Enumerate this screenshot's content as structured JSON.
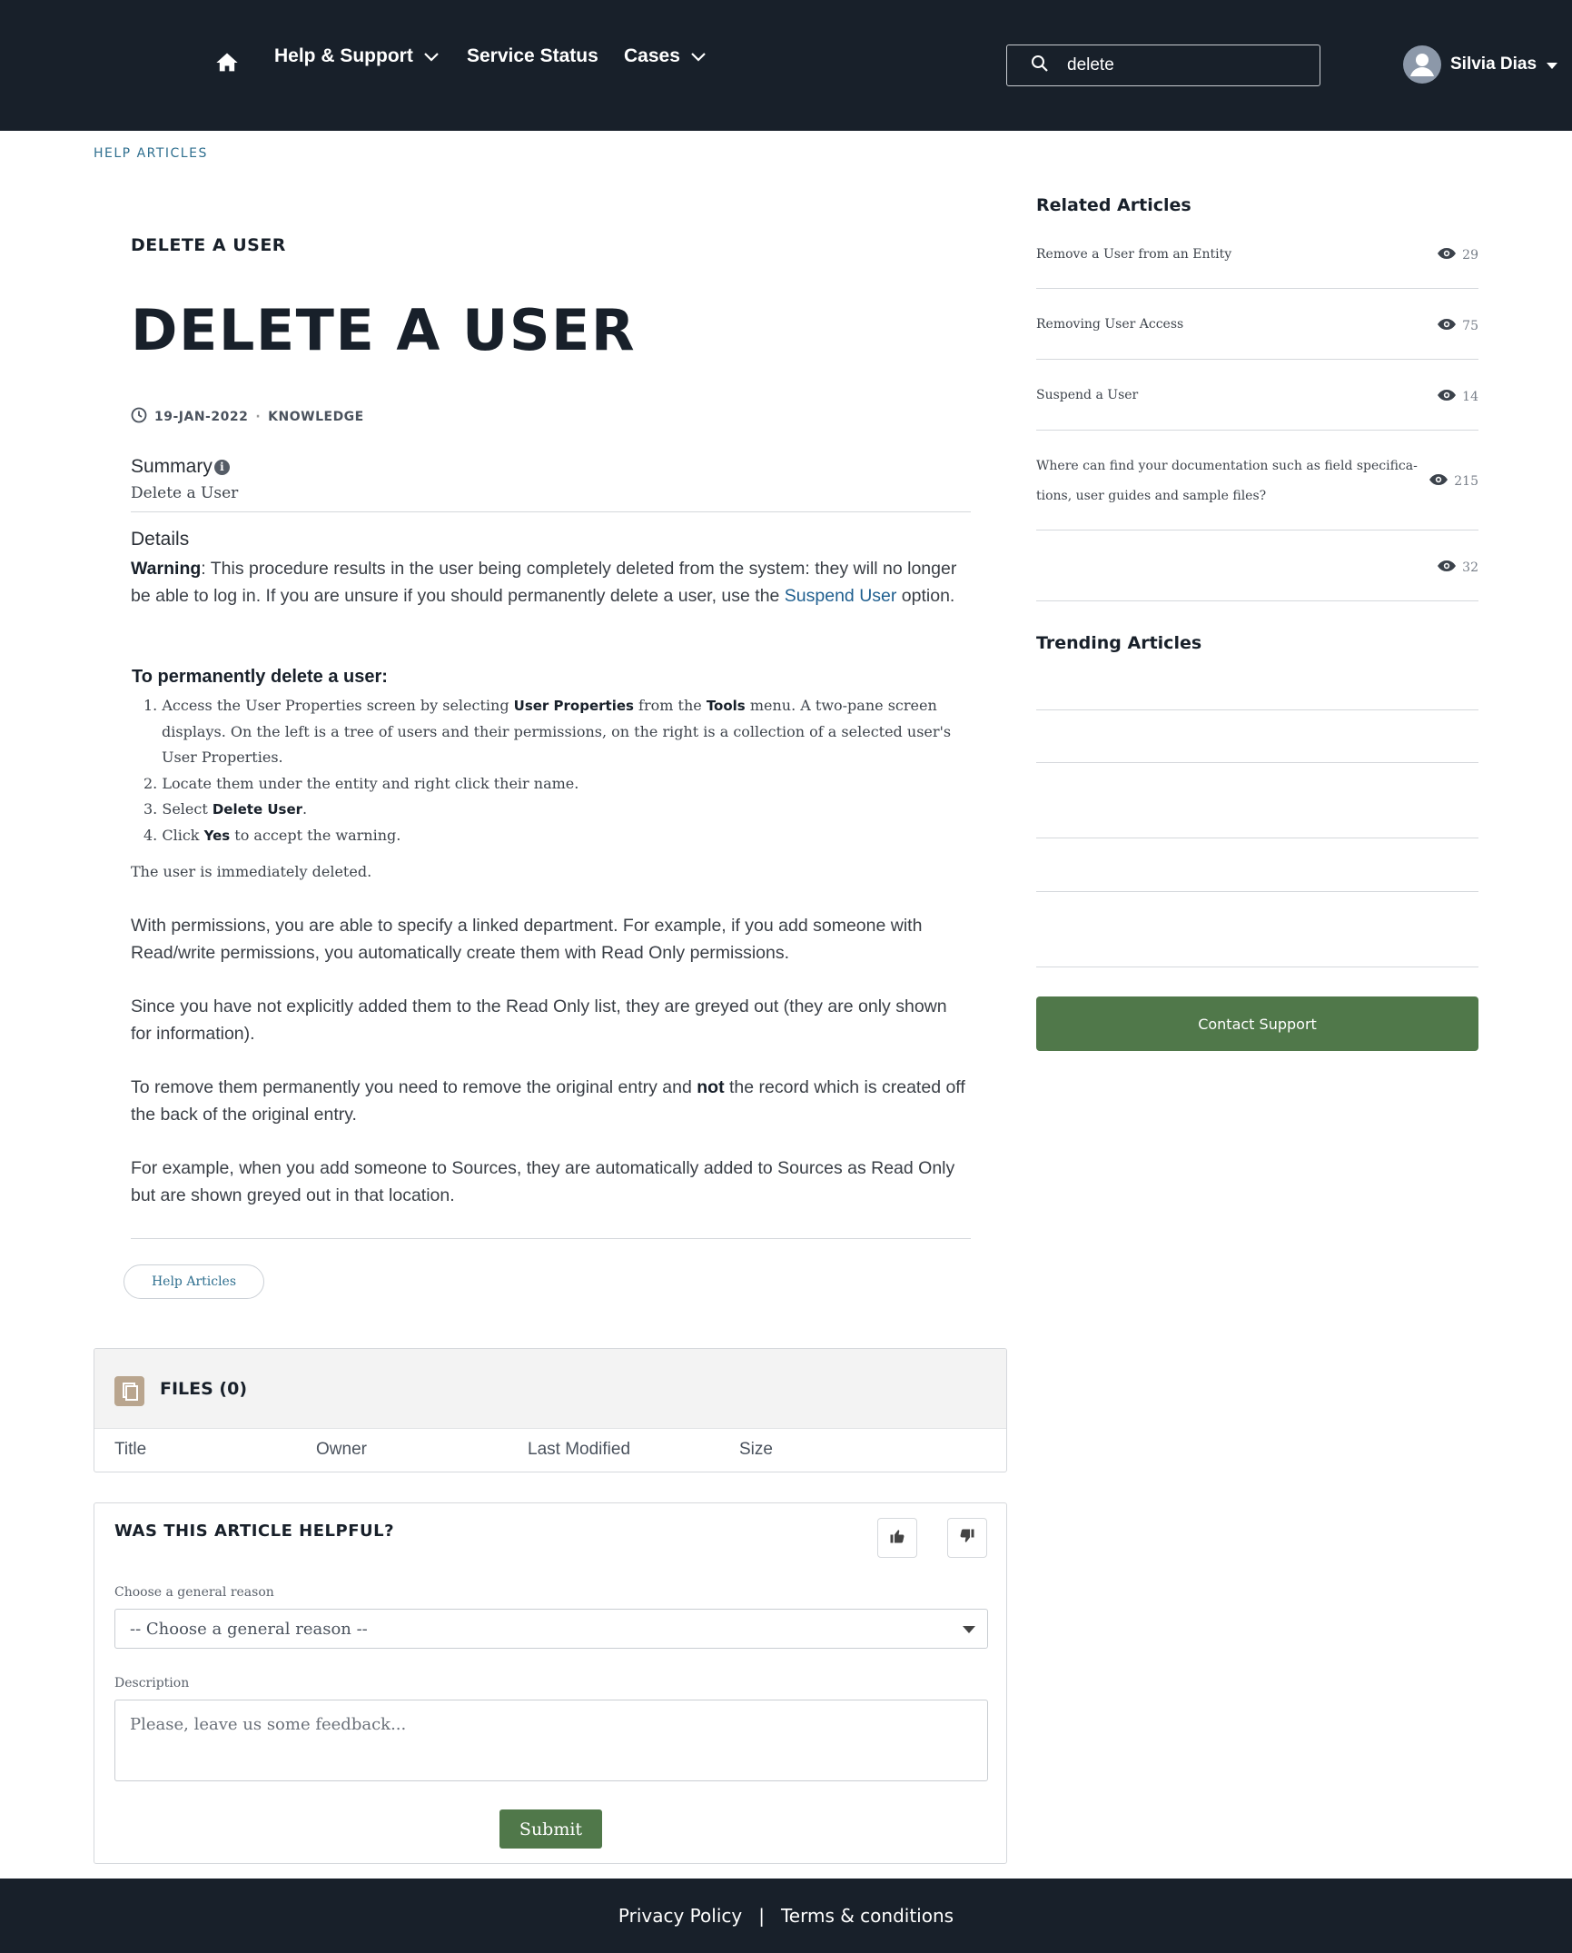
{
  "header": {
    "nav": {
      "home_icon": "home-icon",
      "help_support": "Help & Support",
      "service_status": "Service Status",
      "cases": "Cases"
    },
    "search": {
      "value": "delete",
      "icon": "search-icon"
    },
    "user": {
      "name": "Silvia Dias",
      "avatar_icon": "user-avatar-icon"
    }
  },
  "breadcrumb": "HELP ARTICLES",
  "article": {
    "subtitle": "DELETE A USER",
    "title": "DELETE A USER",
    "date": "19-JAN-2022",
    "meta_separator": "·",
    "category": "KNOWLEDGE",
    "summary_label": "Summary",
    "summary_value": "Delete a User",
    "details_label": "Details",
    "warning_label": "Warning",
    "warning_text": ": This procedure results in the user being completely deleted from the system: they will no longer be able to log in. If you are unsure if you should permanently delete a user, use the ",
    "warning_link": "Suspend User",
    "warning_tail": " option.",
    "steps_heading": "To permanently delete a user:",
    "steps": [
      {
        "n": "1.",
        "a": "Access the User Properties screen by selecting ",
        "b1": "User Properties",
        "c": " from the ",
        "b2": "Tools",
        "d": " menu. A two-pane screen displays. On the left is a tree of users and their permissions, on the right is a collection of a selected user's User Properties."
      },
      {
        "n": "2.",
        "a": "Locate them under the entity and right click their name."
      },
      {
        "n": "3.",
        "a": "Select ",
        "b1": "Delete User",
        "c": "."
      },
      {
        "n": "4.",
        "a": "Click ",
        "b1": "Yes",
        "c": " to accept the warning."
      }
    ],
    "deleted_note": "The user is immediately deleted.",
    "para1": "With permissions, you are able to specify a linked department. For example, if you add someone with Read/write permissions, you automatically create them with Read Only permissions.",
    "para2": "Since you have not explicitly added them to the Read Only list, they are greyed out (they are only shown for information).",
    "para3_a": "To remove them permanently you need to remove the original entry and ",
    "para3_b": "not",
    "para3_c": " the record which is created off the back of the original entry.",
    "para4": "For example, when you add someone to Sources, they are automatically added to Sources as Read Only but are shown greyed out in that location.",
    "topic": "Help Articles"
  },
  "files": {
    "title": "FILES (0)",
    "icon": "files-icon",
    "columns": [
      "Title",
      "Owner",
      "Last Modified",
      "Size"
    ]
  },
  "feedback": {
    "title": "WAS THIS ARTICLE HELPFUL?",
    "thumbs_up_icon": "thumbs-up-icon",
    "thumbs_down_icon": "thumbs-down-icon",
    "reason_label": "Choose a general reason",
    "reason_selected": "-- Choose a general reason --",
    "description_label": "Description",
    "description_placeholder": "Please, leave us some feedback...",
    "submit": "Submit"
  },
  "sidebar": {
    "related_heading": "Related Articles",
    "related": [
      {
        "title": "Remove a User from an Entity",
        "views": "29"
      },
      {
        "title": "Removing User Access",
        "views": "75"
      },
      {
        "title": "Suspend a User",
        "views": "14"
      },
      {
        "title": "Where can find your documentation such as field specifica-tions, user guides and sample files?",
        "views": "215"
      },
      {
        "title": "",
        "views": "32"
      }
    ],
    "trending_heading": "Trending Articles",
    "contact": "Contact Support"
  },
  "footer": {
    "privacy": "Privacy Policy",
    "separator": "|",
    "terms": "Terms & conditions"
  },
  "colors": {
    "header_bg": "#18202a",
    "accent_green": "#50784a",
    "link_blue": "#1f5f8f"
  }
}
